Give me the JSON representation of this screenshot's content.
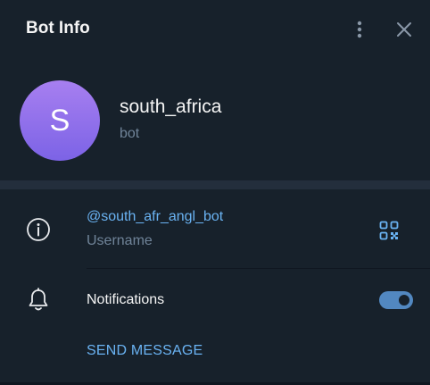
{
  "header": {
    "title": "Bot Info",
    "menu_icon": "kebab-vertical-icon",
    "close_icon": "close-icon"
  },
  "profile": {
    "avatar_letter": "S",
    "name": "south_africa",
    "subtitle": "bot"
  },
  "info": {
    "username_icon": "info-circle-icon",
    "username": "@south_afr_angl_bot",
    "username_label": "Username",
    "qr_icon": "qr-code-icon",
    "notifications_icon": "bell-icon",
    "notifications_label": "Notifications",
    "notifications_enabled": true,
    "send_message_label": "SEND MESSAGE"
  },
  "colors": {
    "background": "#17212b",
    "divider": "#232e3c",
    "accent": "#6ab3f3",
    "toggle": "#5288c1",
    "muted_text": "#708499",
    "avatar_gradient_top": "#a77ff0",
    "avatar_gradient_bottom": "#7c63e6"
  }
}
